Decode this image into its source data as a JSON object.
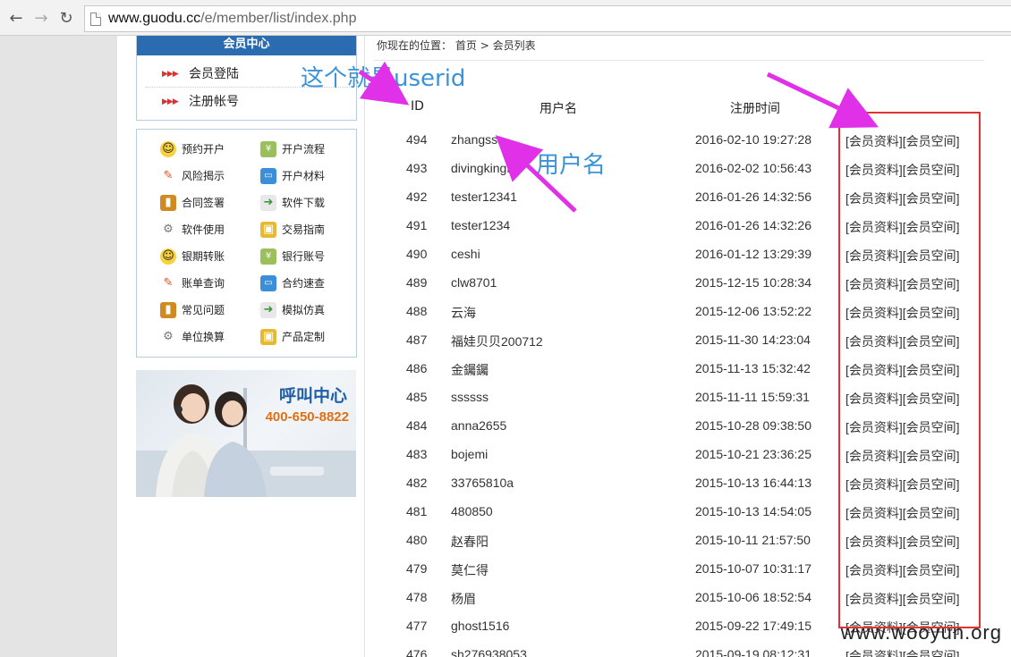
{
  "browser": {
    "url_host": "www.guodu.cc",
    "url_path": "/e/member/list/index.php"
  },
  "sidebar": {
    "member_center_title": "会员中心",
    "login_links": [
      "会员登陆",
      "注册帐号"
    ],
    "menu_left": [
      "预约开户",
      "风险揭示",
      "合同签署",
      "软件使用",
      "银期转账",
      "账单查询",
      "常见问题",
      "单位换算"
    ],
    "menu_right": [
      "开户流程",
      "开户材料",
      "软件下载",
      "交易指南",
      "银行账号",
      "合约速查",
      "模拟仿真",
      "产品定制"
    ],
    "call_center": {
      "title": "呼叫中心",
      "phone": "400-650-8822"
    }
  },
  "breadcrumb": {
    "label": "你现在的位置：",
    "home": "首页",
    "sep": ">",
    "current": "会员列表"
  },
  "table": {
    "headers": {
      "id": "ID",
      "username": "用户名",
      "regtime": "注册时间"
    },
    "rows": [
      {
        "id": "494",
        "name": "zhangsss",
        "time": "2016-02-10 19:27:28"
      },
      {
        "id": "493",
        "name": "divingkingf",
        "time": "2016-02-02 10:56:43"
      },
      {
        "id": "492",
        "name": "tester12341",
        "time": "2016-01-26 14:32:56"
      },
      {
        "id": "491",
        "name": "tester1234",
        "time": "2016-01-26 14:32:26"
      },
      {
        "id": "490",
        "name": "ceshi",
        "time": "2016-01-12 13:29:39"
      },
      {
        "id": "489",
        "name": "clw8701",
        "time": "2015-12-15 10:28:34"
      },
      {
        "id": "488",
        "name": "云海",
        "time": "2015-12-06 13:52:22"
      },
      {
        "id": "487",
        "name": "福娃贝贝200712",
        "time": "2015-11-30 14:23:04"
      },
      {
        "id": "486",
        "name": "金钃钃",
        "time": "2015-11-13 15:32:42"
      },
      {
        "id": "485",
        "name": "ssssss",
        "time": "2015-11-11 15:59:31"
      },
      {
        "id": "484",
        "name": "anna2655",
        "time": "2015-10-28 09:38:50"
      },
      {
        "id": "483",
        "name": "bojemi",
        "time": "2015-10-21 23:36:25"
      },
      {
        "id": "482",
        "name": "33765810a",
        "time": "2015-10-13 16:44:13"
      },
      {
        "id": "481",
        "name": "480850",
        "time": "2015-10-13 14:54:05"
      },
      {
        "id": "480",
        "name": "赵春阳",
        "time": "2015-10-11 21:57:50"
      },
      {
        "id": "479",
        "name": "莫仁得",
        "time": "2015-10-07 10:31:17"
      },
      {
        "id": "478",
        "name": "杨眉",
        "time": "2015-10-06 18:52:54"
      },
      {
        "id": "477",
        "name": "ghost1516",
        "time": "2015-09-22 17:49:15"
      },
      {
        "id": "476",
        "name": "sh276938053",
        "time": "2015-09-19 08:12:31"
      }
    ],
    "action_profile": "[会员资料]",
    "action_space": "[会员空间]"
  },
  "annotations": {
    "userid": "这个就是userid",
    "username": "用户名"
  },
  "watermark": "www.wooyun.org",
  "colors": {
    "accent_blue": "#2b6cb0",
    "arrow_magenta": "#e030e8",
    "highlight_red": "#e23131",
    "annotation_blue": "#3a93d8"
  }
}
